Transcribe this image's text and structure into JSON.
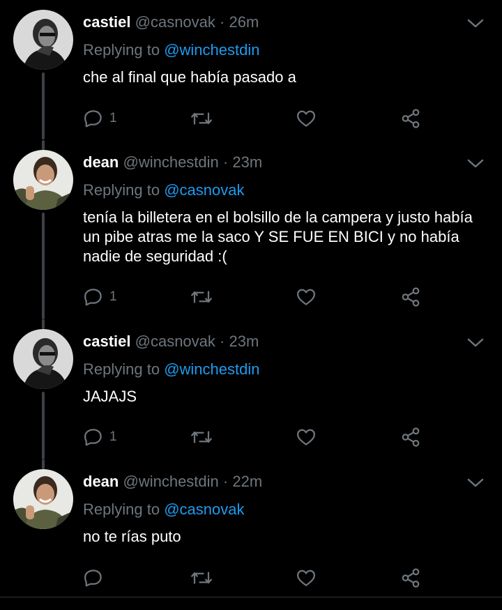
{
  "tweets": [
    {
      "name": "castiel",
      "handle": "@casnovak",
      "separator": "·",
      "time": "26m",
      "replying_prefix": "Replying to",
      "replying_to": "@winchestdin",
      "text": "che al final que había pasado a",
      "reply_count": "1",
      "avatar_icon": "avatar-castiel"
    },
    {
      "name": "dean",
      "handle": "@winchestdin",
      "separator": "·",
      "time": "23m",
      "replying_prefix": "Replying to",
      "replying_to": "@casnovak",
      "text": "tenía la billetera en el bolsillo de la campera y justo había un pibe atras me la saco Y SE FUE EN BICI y no había nadie de seguridad :(",
      "reply_count": "1",
      "avatar_icon": "avatar-dean"
    },
    {
      "name": "castiel",
      "handle": "@casnovak",
      "separator": "·",
      "time": "23m",
      "replying_prefix": "Replying to",
      "replying_to": "@winchestdin",
      "text": "JAJAJS",
      "reply_count": "1",
      "avatar_icon": "avatar-castiel"
    },
    {
      "name": "dean",
      "handle": "@winchestdin",
      "separator": "·",
      "time": "22m",
      "replying_prefix": "Replying to",
      "replying_to": "@casnovak",
      "text": "no te rías puto",
      "reply_count": "",
      "avatar_icon": "avatar-dean"
    }
  ],
  "icons": {
    "reply": "reply-icon",
    "retweet": "retweet-icon",
    "like": "like-icon",
    "share": "share-icon",
    "more": "chevron-down-icon"
  },
  "colors": {
    "background": "#000000",
    "text": "#ffffff",
    "secondary": "#6e767d",
    "link": "#1d9bf0",
    "thread_line": "#3d4146"
  }
}
